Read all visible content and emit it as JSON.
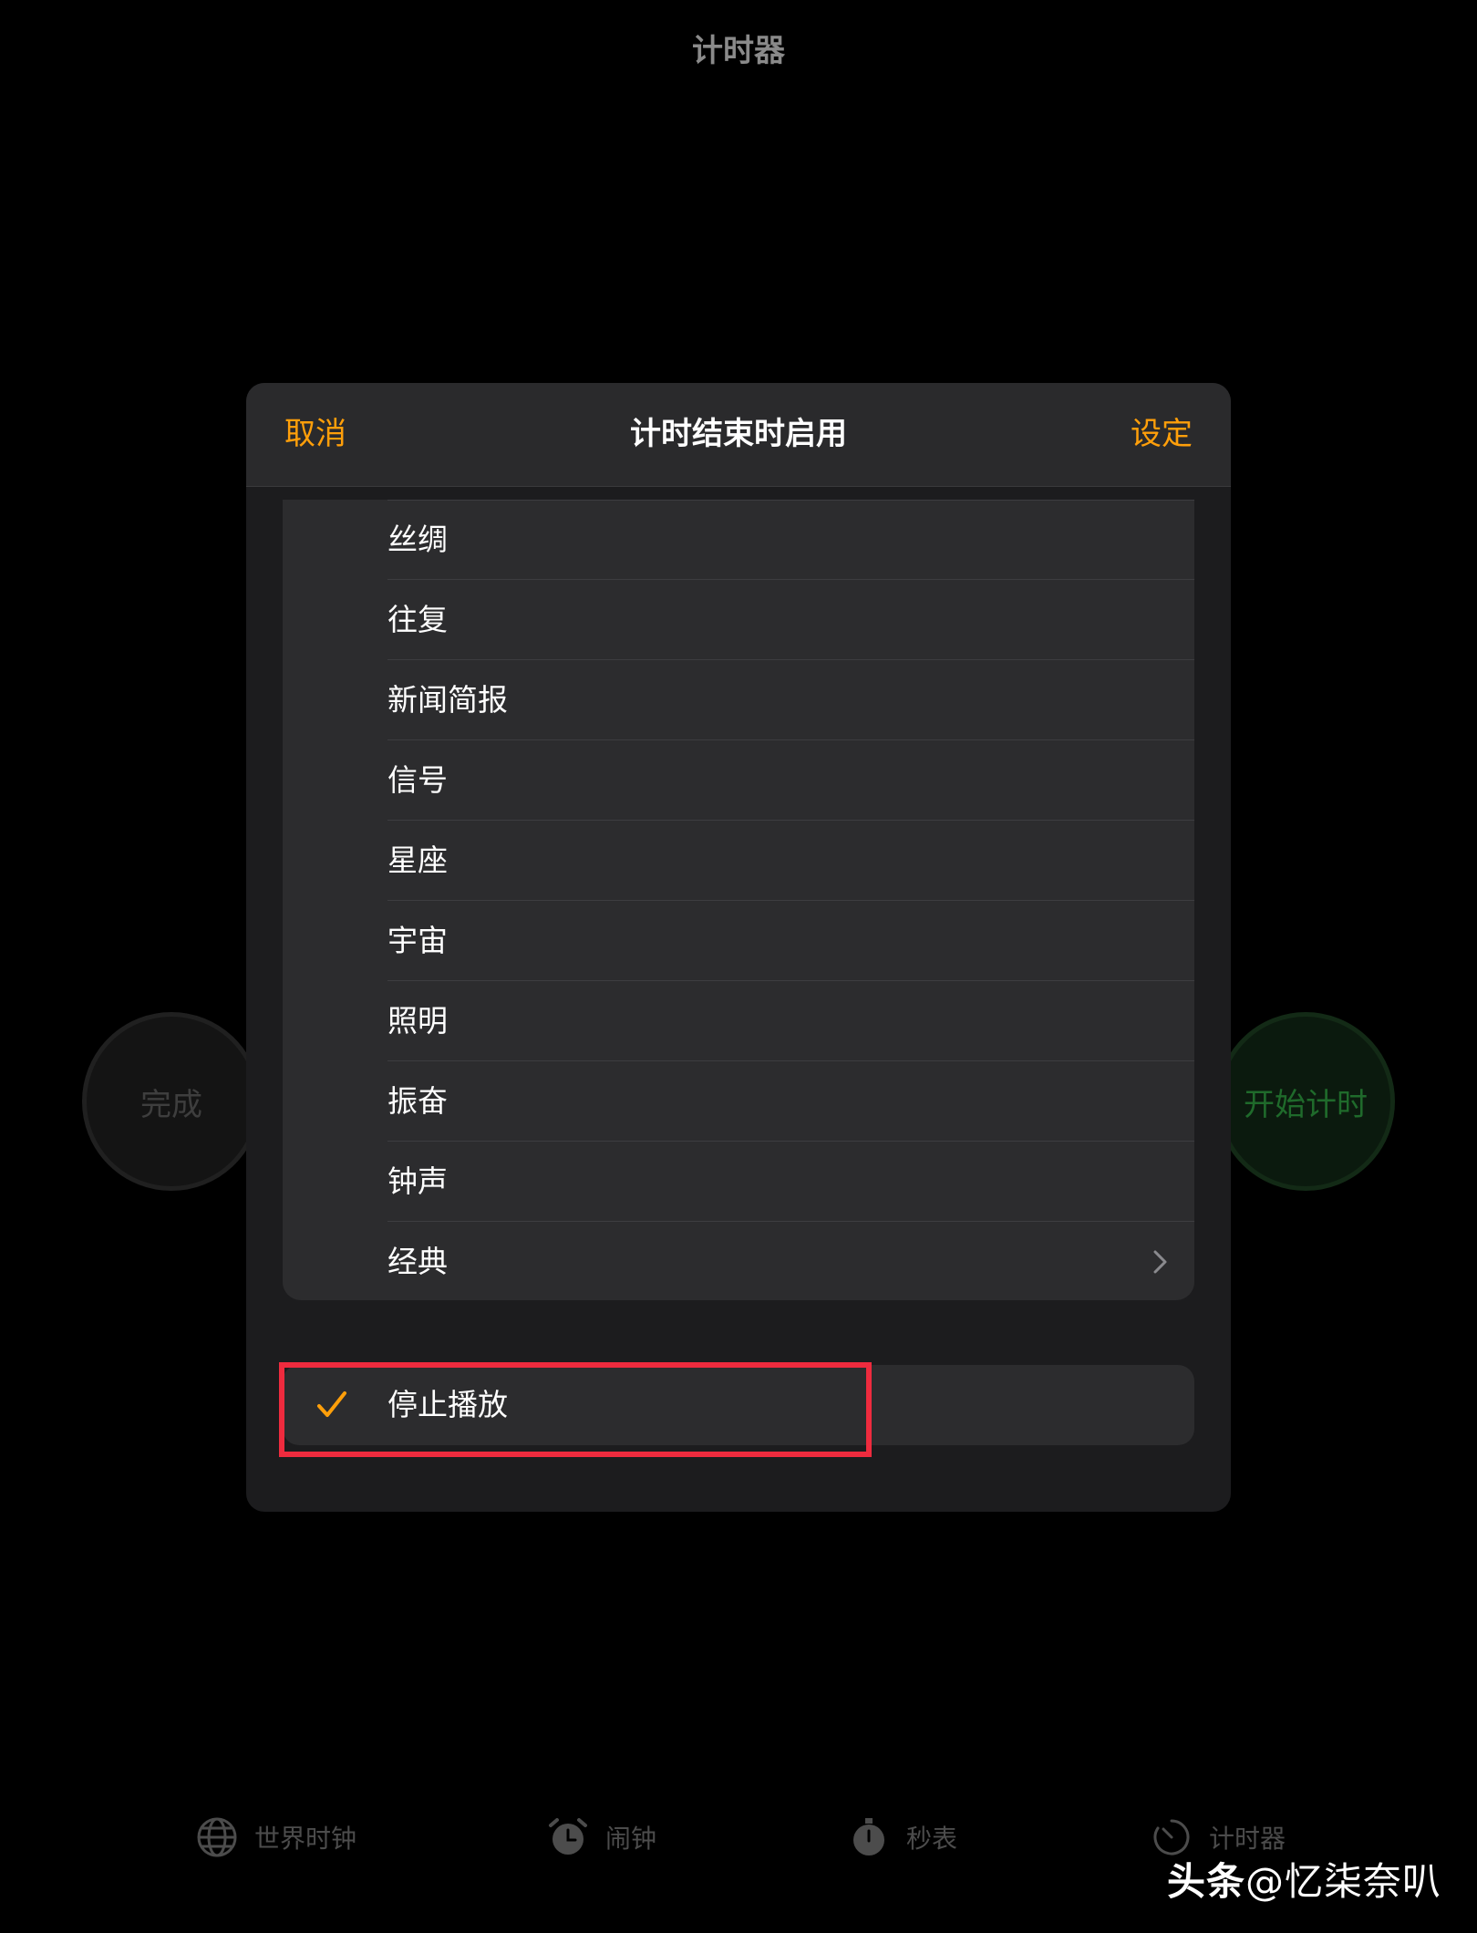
{
  "app": {
    "title": "计时器",
    "done_button": "完成",
    "start_button": "开始计时"
  },
  "sheet": {
    "cancel_label": "取消",
    "title": "计时结束时启用",
    "set_label": "设定",
    "sounds": [
      {
        "label": "丝绸"
      },
      {
        "label": "往复"
      },
      {
        "label": "新闻简报"
      },
      {
        "label": "信号"
      },
      {
        "label": "星座"
      },
      {
        "label": "宇宙"
      },
      {
        "label": "照明"
      },
      {
        "label": "振奋"
      },
      {
        "label": "钟声"
      },
      {
        "label": "经典",
        "has_disclosure": true
      }
    ],
    "stop_playing": {
      "label": "停止播放",
      "checked": true
    }
  },
  "tabbar": {
    "items": [
      {
        "label": "世界时钟",
        "icon": "globe-icon"
      },
      {
        "label": "闹钟",
        "icon": "alarm-clock-icon"
      },
      {
        "label": "秒表",
        "icon": "stopwatch-icon"
      },
      {
        "label": "计时器",
        "icon": "timer-icon"
      }
    ]
  },
  "watermark": {
    "brand": "头条",
    "handle": "@忆柒奈叭"
  },
  "colors": {
    "accent": "#ff9f0a",
    "highlight": "#ee2b3e",
    "start_green": "#1f6a2b"
  }
}
